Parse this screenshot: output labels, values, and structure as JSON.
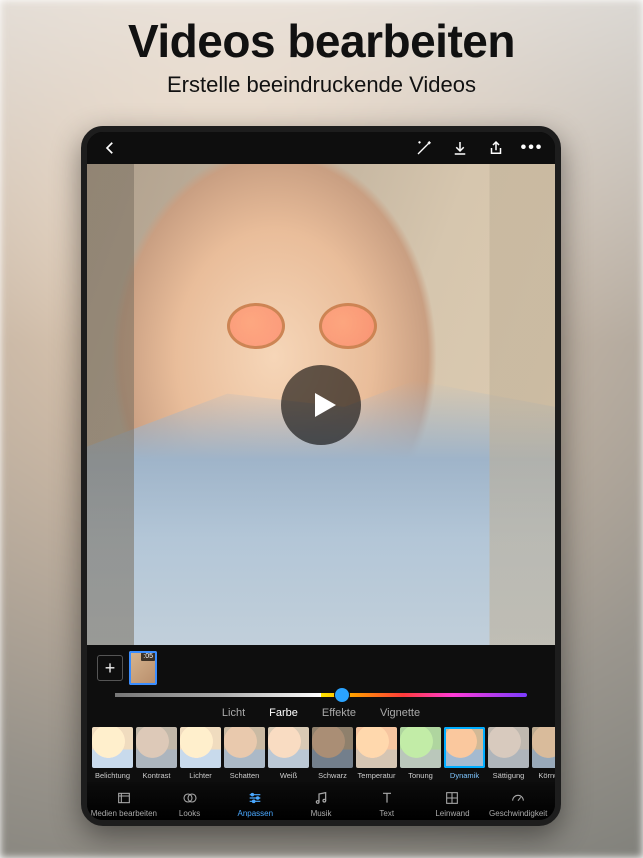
{
  "hero": {
    "title": "Videos bearbeiten",
    "subtitle": "Erstelle beeindruckende Videos"
  },
  "clip": {
    "duration": ":05"
  },
  "slider": {
    "value_percent": 55
  },
  "adjust_tabs": {
    "active_index": 1,
    "items": [
      {
        "label": "Licht"
      },
      {
        "label": "Farbe"
      },
      {
        "label": "Effekte"
      },
      {
        "label": "Vignette"
      }
    ]
  },
  "filters": {
    "active_index": 8,
    "items": [
      {
        "label": "Belichtung",
        "tone": "t-hi"
      },
      {
        "label": "Kontrast",
        "tone": "t-bw"
      },
      {
        "label": "Lichter",
        "tone": "t-hi"
      },
      {
        "label": "Schatten",
        "tone": "t-sh"
      },
      {
        "label": "Weiß",
        "tone": "t-wht"
      },
      {
        "label": "Schwarz",
        "tone": "t-blk"
      },
      {
        "label": "Temperatur",
        "tone": "t-temp"
      },
      {
        "label": "Tonung",
        "tone": "t-tone"
      },
      {
        "label": "Dynamik",
        "tone": "t-dyn"
      },
      {
        "label": "Sättigung",
        "tone": "t-sat2"
      },
      {
        "label": "Körnung",
        "tone": "t-grn"
      }
    ]
  },
  "nav": {
    "active_index": 2,
    "items": [
      {
        "label": "Medien bearbeiten",
        "icon": "frame"
      },
      {
        "label": "Looks",
        "icon": "rings"
      },
      {
        "label": "Anpassen",
        "icon": "sliders"
      },
      {
        "label": "Musik",
        "icon": "music"
      },
      {
        "label": "Text",
        "icon": "text"
      },
      {
        "label": "Leinwand",
        "icon": "grid"
      },
      {
        "label": "Geschwindigkeit",
        "icon": "gauge"
      }
    ]
  }
}
